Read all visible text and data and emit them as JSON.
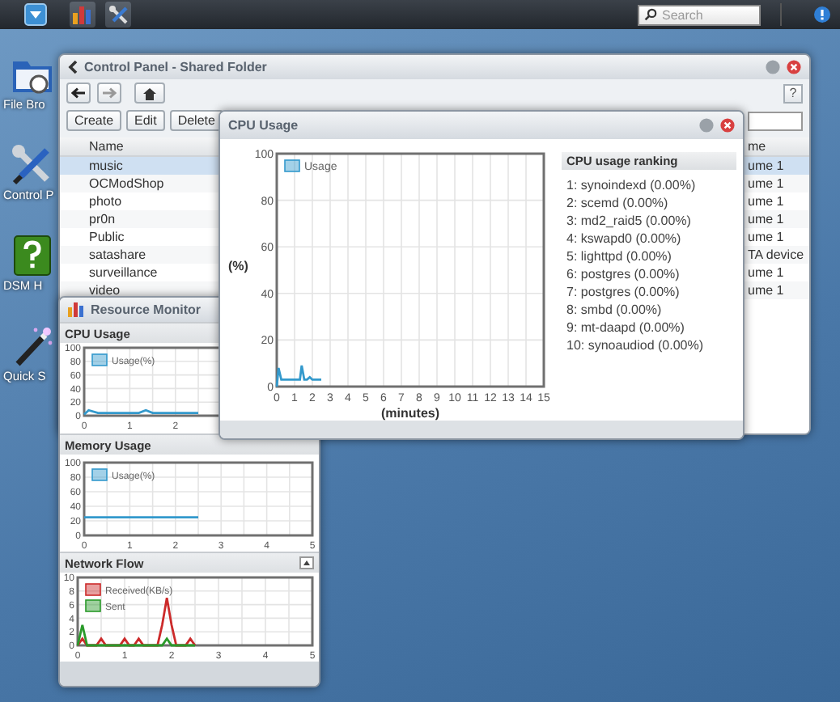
{
  "taskbar": {
    "search": {
      "placeholder": "Search"
    }
  },
  "desktop_icons": [
    {
      "label": "File Bro",
      "kind": "folder"
    },
    {
      "label": "Control P",
      "kind": "tools"
    },
    {
      "label": "DSM H",
      "kind": "help"
    },
    {
      "label": "Quick S",
      "kind": "wand"
    }
  ],
  "control_panel": {
    "title": "Control Panel - Shared Folder",
    "help_button": "?",
    "buttons": [
      "Create",
      "Edit",
      "Delete"
    ],
    "table": {
      "columns": [
        "Name",
        "me"
      ],
      "rows": [
        {
          "name": "music",
          "column_2": "ume 1",
          "selected": true
        },
        {
          "name": "OCModShop",
          "column_2": "ume 1",
          "selected": false
        },
        {
          "name": "photo",
          "column_2": "ume 1",
          "selected": false
        },
        {
          "name": "pr0n",
          "column_2": "ume 1",
          "selected": false
        },
        {
          "name": "Public",
          "column_2": "ume 1",
          "selected": false
        },
        {
          "name": "satashare",
          "column_2": "TA device",
          "selected": false
        },
        {
          "name": "surveillance",
          "column_2": "ume 1",
          "selected": false
        },
        {
          "name": "video",
          "column_2": "ume 1",
          "selected": false
        }
      ]
    }
  },
  "cpu_window": {
    "title": "CPU Usage",
    "chart_data": {
      "type": "line",
      "xlabel": "(minutes)",
      "ylabel": "(%)",
      "x": [
        0,
        0.1,
        0.25,
        0.5,
        1,
        1.3,
        1.4,
        1.55,
        1.7,
        1.85,
        2,
        2.5
      ],
      "series": [
        {
          "name": "Usage",
          "color": "#3399cc",
          "values": [
            0,
            8,
            3,
            3,
            3,
            3,
            9,
            3,
            3,
            4,
            3,
            3
          ]
        }
      ],
      "grid": true,
      "legend": "top-left",
      "xlim": [
        0,
        15
      ],
      "ylim": [
        0,
        100
      ],
      "xticks": [
        0,
        1,
        2,
        3,
        4,
        5,
        6,
        7,
        8,
        9,
        10,
        11,
        12,
        13,
        14,
        15
      ],
      "yticks": [
        0,
        20,
        40,
        60,
        80,
        100
      ]
    },
    "ranking": {
      "title": "CPU usage ranking",
      "items": [
        "1: synoindexd (0.00%)",
        "2: scemd (0.00%)",
        "3: md2_raid5 (0.00%)",
        "4: kswapd0 (0.00%)",
        "5: lighttpd (0.00%)",
        "6: postgres (0.00%)",
        "7: postgres (0.00%)",
        "8: smbd (0.00%)",
        "9: mt-daapd (0.00%)",
        "10: synoaudiod (0.00%)"
      ]
    }
  },
  "resource_monitor": {
    "title": "Resource Monitor",
    "sections": [
      {
        "title": "CPU Usage",
        "chart_data": {
          "type": "line",
          "x": [
            0,
            0.1,
            0.3,
            1.2,
            1.35,
            1.5,
            2.5
          ],
          "series": [
            {
              "name": "Usage(%)",
              "color": "#3399cc",
              "values": [
                2,
                8,
                4,
                4,
                8,
                4,
                4
              ]
            }
          ],
          "grid": true,
          "legend": "top-left",
          "xlim": [
            0,
            5
          ],
          "ylim": [
            0,
            100
          ],
          "xticks": [
            0,
            1,
            2
          ],
          "yticks": [
            0,
            20,
            40,
            60,
            80,
            100
          ]
        }
      },
      {
        "title": "Memory Usage",
        "chart_data": {
          "type": "line",
          "x": [
            0,
            2.5
          ],
          "series": [
            {
              "name": "Usage(%)",
              "color": "#3399cc",
              "values": [
                25,
                25
              ]
            }
          ],
          "grid": true,
          "legend": "top-left",
          "xlim": [
            0,
            5
          ],
          "ylim": [
            0,
            100
          ],
          "xticks": [
            0,
            1,
            2,
            3,
            4,
            5
          ],
          "yticks": [
            0,
            20,
            40,
            60,
            80,
            100
          ]
        }
      },
      {
        "title": "Network Flow",
        "collapsible": true,
        "chart_data": {
          "type": "line",
          "x": [
            0,
            0.1,
            0.2,
            0.4,
            0.5,
            0.6,
            0.9,
            1,
            1.1,
            1.2,
            1.3,
            1.4,
            1.7,
            1.8,
            1.9,
            2.0,
            2.1,
            2.3,
            2.4,
            2.5
          ],
          "series": [
            {
              "name": "Received(KB/s)",
              "color": "#cc2a2a",
              "values": [
                0,
                1,
                0,
                0,
                1,
                0,
                0,
                1,
                0,
                0,
                1,
                0,
                0,
                3,
                7,
                3,
                0,
                0,
                1,
                0
              ]
            },
            {
              "name": "Sent",
              "color": "#2a9a2a",
              "values": [
                0,
                3,
                0,
                0,
                0,
                0,
                0,
                0,
                0,
                0,
                0,
                0,
                0,
                0,
                1,
                0,
                0,
                0,
                0,
                0
              ]
            }
          ],
          "grid": true,
          "legend": "top-left",
          "xlim": [
            0,
            5
          ],
          "ylim": [
            0,
            10
          ],
          "xticks": [
            0,
            1,
            2,
            3,
            4,
            5
          ],
          "yticks": [
            0,
            2,
            4,
            6,
            8,
            10
          ]
        }
      }
    ]
  }
}
